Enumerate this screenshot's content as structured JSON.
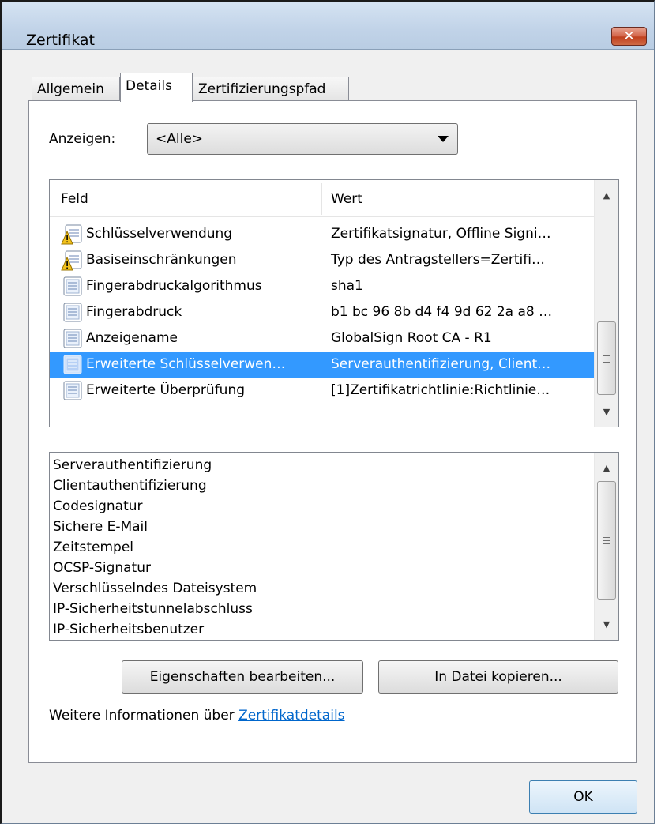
{
  "window": {
    "title": "Zertifikat",
    "close_glyph": "✕"
  },
  "tabs": [
    {
      "label": "Allgemein",
      "active": false
    },
    {
      "label": "Details",
      "active": true
    },
    {
      "label": "Zertifizierungspfad",
      "active": false
    }
  ],
  "filter": {
    "label": "Anzeigen:",
    "value": "<Alle>"
  },
  "fields_list": {
    "columns": [
      "Feld",
      "Wert"
    ],
    "rows": [
      {
        "field": "Schlüsselverwendung",
        "value": "Zertifikatsignatur, Offline Signi…",
        "icon": "certificate-field-warning-icon",
        "selected": false
      },
      {
        "field": "Basiseinschränkungen",
        "value": "Typ des Antragstellers=Zertifi…",
        "icon": "certificate-field-warning-icon",
        "selected": false
      },
      {
        "field": "Fingerabdruckalgorithmus",
        "value": "sha1",
        "icon": "certificate-field-icon",
        "selected": false
      },
      {
        "field": "Fingerabdruck",
        "value": "b1 bc 96 8b d4 f4 9d 62 2a a8 …",
        "icon": "certificate-field-icon",
        "selected": false
      },
      {
        "field": "Anzeigename",
        "value": "GlobalSign Root CA - R1",
        "icon": "certificate-field-icon",
        "selected": false
      },
      {
        "field": "Erweiterte Schlüsselverwen…",
        "value": "Serverauthentifizierung, Client…",
        "icon": "certificate-field-icon",
        "selected": true
      },
      {
        "field": "Erweiterte Überprüfung",
        "value": "[1]Zertifikatrichtlinie:Richtlinie…",
        "icon": "certificate-field-icon",
        "selected": false
      }
    ]
  },
  "detail_lines": [
    "Serverauthentifizierung",
    "Clientauthentifizierung",
    "Codesignatur",
    "Sichere E-Mail",
    "Zeitstempel",
    "OCSP-Signatur",
    "Verschlüsselndes Dateisystem",
    "IP-Sicherheitstunnelabschluss",
    "IP-Sicherheitsbenutzer"
  ],
  "buttons": {
    "edit_properties": "Eigenschaften bearbeiten...",
    "copy_to_file": "In Datei kopieren...",
    "ok": "OK"
  },
  "info": {
    "prefix": "Weitere Informationen über ",
    "link": "Zertifikatdetails"
  },
  "colors": {
    "selection": "#3399ff",
    "link": "#0066cc",
    "close_button": "#c0411f"
  }
}
